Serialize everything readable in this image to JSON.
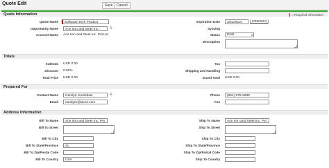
{
  "page": {
    "title": "Quote Edit"
  },
  "toolbar": {
    "save_label": "Save",
    "cancel_label": "Cancel"
  },
  "required_note": "= Required Information",
  "quote_info": {
    "heading": "Quote Information",
    "quote_name_label": "Quote Name",
    "quote_name_value": "Software Tech Product",
    "opportunity_name_label": "Opportunity Name",
    "opportunity_name_value": "Ace Iron and Steel Inc.-",
    "account_name_label": "Account Name",
    "account_name_value": "Ace Iron and Steel Inc. Pvt.Ltd",
    "expiration_date_label": "Expiration Date",
    "expiration_date_value": "3/31/2024",
    "today_date_link": "[ 3/28/2024 ]",
    "syncing_label": "Syncing",
    "status_label": "Status",
    "status_value": "Draft",
    "description_label": "Description"
  },
  "totals": {
    "heading": "Totals",
    "subtotal_label": "Subtotal",
    "subtotal_value": "USD 0.00",
    "discount_label": "Discount",
    "discount_value": "0.00%",
    "total_price_label": "Total Price",
    "total_price_value": "USD 0.00",
    "tax_label": "Tax",
    "shipping_label": "Shipping and Handling",
    "grand_total_label": "Grand Total",
    "grand_total_value": "USD 0.00"
  },
  "prepared_for": {
    "heading": "Prepared For",
    "contact_name_label": "Contact Name",
    "contact_name_value": "Carolyn Crenshaw",
    "email_label": "Email",
    "email_value": "carolync@aces.com",
    "phone_label": "Phone",
    "phone_value": "(251) 679-2200",
    "fax_label": "Fax"
  },
  "address_info": {
    "heading": "Address Information",
    "bill_to_name_label": "Bill To Name",
    "bill_to_name_value": "Ace Iron and Steel Inc. Pvt",
    "bill_to_street_label": "Bill To Street",
    "bill_to_city_label": "Bill To City",
    "bill_to_state_label": "Bill To State/Province",
    "bill_to_state_value": "AL",
    "bill_to_zip_label": "Bill To Zip/Postal Code",
    "bill_to_country_label": "Bill To Country",
    "bill_to_country_value": "USA",
    "ship_to_name_label": "Ship To Name",
    "ship_to_name_value": "Ace Iron and Steel Inc. Pvt",
    "ship_to_street_label": "Ship To Street",
    "ship_to_city_label": "Ship To City",
    "ship_to_state_label": "Ship To State/Province",
    "ship_to_zip_label": "Ship To Zip/Postal Code",
    "ship_to_country_label": "Ship To Country"
  }
}
